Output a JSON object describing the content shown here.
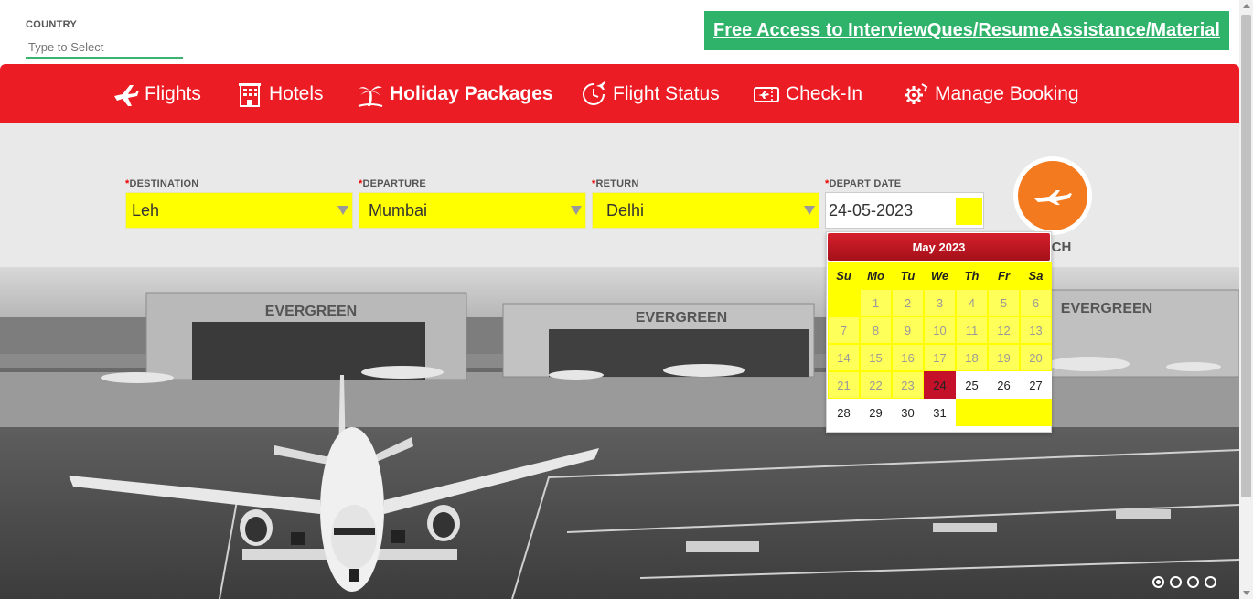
{
  "country": {
    "label": "COUNTRY",
    "placeholder": "Type to Select"
  },
  "promo": {
    "text": "Free Access to InterviewQues/ResumeAssistance/Material"
  },
  "nav": {
    "items": [
      {
        "label": "Flights",
        "icon": "plane-icon"
      },
      {
        "label": "Hotels",
        "icon": "hotel-icon"
      },
      {
        "label": "Holiday Packages",
        "icon": "palm-tree-icon",
        "active": true
      },
      {
        "label": "Flight Status",
        "icon": "clock-plane-icon"
      },
      {
        "label": "Check-In",
        "icon": "ticket-icon"
      },
      {
        "label": "Manage Booking",
        "icon": "gear-icon"
      }
    ]
  },
  "form": {
    "destination": {
      "label": "DESTINATION",
      "value": "Leh"
    },
    "departure": {
      "label": "DEPARTURE",
      "value": "Mumbai"
    },
    "return": {
      "label": "RETURN",
      "value": "Delhi"
    },
    "depart_date": {
      "label": "DEPART DATE",
      "value": "24-05-2023"
    },
    "search": {
      "label": "ARCH"
    }
  },
  "calendar": {
    "month_title": "May 2023",
    "weekdays": [
      "Su",
      "Mo",
      "Tu",
      "We",
      "Th",
      "Fr",
      "Sa"
    ],
    "weeks": [
      [
        "",
        "1",
        "2",
        "3",
        "4",
        "5",
        "6"
      ],
      [
        "7",
        "8",
        "9",
        "10",
        "11",
        "12",
        "13"
      ],
      [
        "14",
        "15",
        "16",
        "17",
        "18",
        "19",
        "20"
      ],
      [
        "21",
        "22",
        "23",
        "24",
        "25",
        "26",
        "27"
      ],
      [
        "28",
        "29",
        "30",
        "31",
        "",
        "",
        ""
      ]
    ],
    "selected_day": "24"
  },
  "hero": {
    "signs": [
      "EVERGREEN",
      "EVERGREEN",
      "EVERGREEN"
    ],
    "slides": 4,
    "active_slide": 1
  },
  "colors": {
    "brand_red": "#ec1c24",
    "field_yellow": "#ffff00",
    "search_orange": "#f47a20",
    "promo_green": "#2fb36b"
  }
}
